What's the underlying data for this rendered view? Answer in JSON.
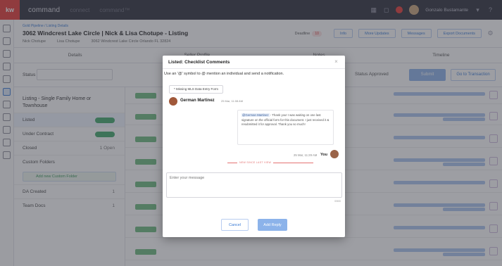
{
  "app": {
    "logo": "kw",
    "brand": "command",
    "nav": [
      "connect",
      "command™"
    ],
    "user_name": "Gonzalo Bustamante"
  },
  "header": {
    "breadcrumb": "Gold Pipeline / Listing Details",
    "title": "3062 Windcrest Lake Circle | Nick & Lisa Chotupe - Listing",
    "meta": [
      "Nick Chotupe",
      "Lisa Chotupe",
      "3062 Windcrest Lake Circle Orlando FL 32824"
    ],
    "buttons": {
      "deadline": "Deadline",
      "deadline_badge": "10",
      "info": "Info",
      "more_updates": "More Updates",
      "messages": "Messages",
      "export": "Export Documents"
    }
  },
  "tabs": [
    "Details",
    "Seller Profile",
    "Notes",
    "Timeline"
  ],
  "status": {
    "label": "Status",
    "approved_label": "Status Approved",
    "submit_btn": "Submit",
    "goto_btn": "Go to Transaction"
  },
  "sidepanel": {
    "header": "Listing - Single Family Home or Townhouse",
    "rows": [
      {
        "label": "Listed",
        "count": ""
      },
      {
        "label": "Under Contract",
        "count": ""
      },
      {
        "label": "Closed",
        "count": "1 Open"
      }
    ],
    "custom_folders": "Custom Folders",
    "add_folder": "Add new Custom Folder",
    "extra_rows": [
      {
        "label": "DA Created",
        "count": "1"
      },
      {
        "label": "Team Docs",
        "count": "1"
      }
    ]
  },
  "modal": {
    "title": "Listed: Checklist Comments",
    "hint": "Use an '@' symbol to @ mention an individual and send a notification.",
    "tag_pill": "* Missing MLS Data Entry Form",
    "comment_author": "German Martinez",
    "comment_time": "25 Mar, 11:08 AM",
    "reply_mention": "@German Martinez",
    "reply_text": " - Thank you! I was waiting on one last signature on the official form for this document. I just received it & resubmitted it for approval. Thank you so much!",
    "reply_time": "25 Mar, 11:29 AM",
    "reply_author": "You",
    "new_divider": "NEW SINCE LAST VIEW",
    "input_placeholder": "Enter your message",
    "char_count": "0/500",
    "cancel_label": "Cancel",
    "add_label": "Add Reply"
  }
}
